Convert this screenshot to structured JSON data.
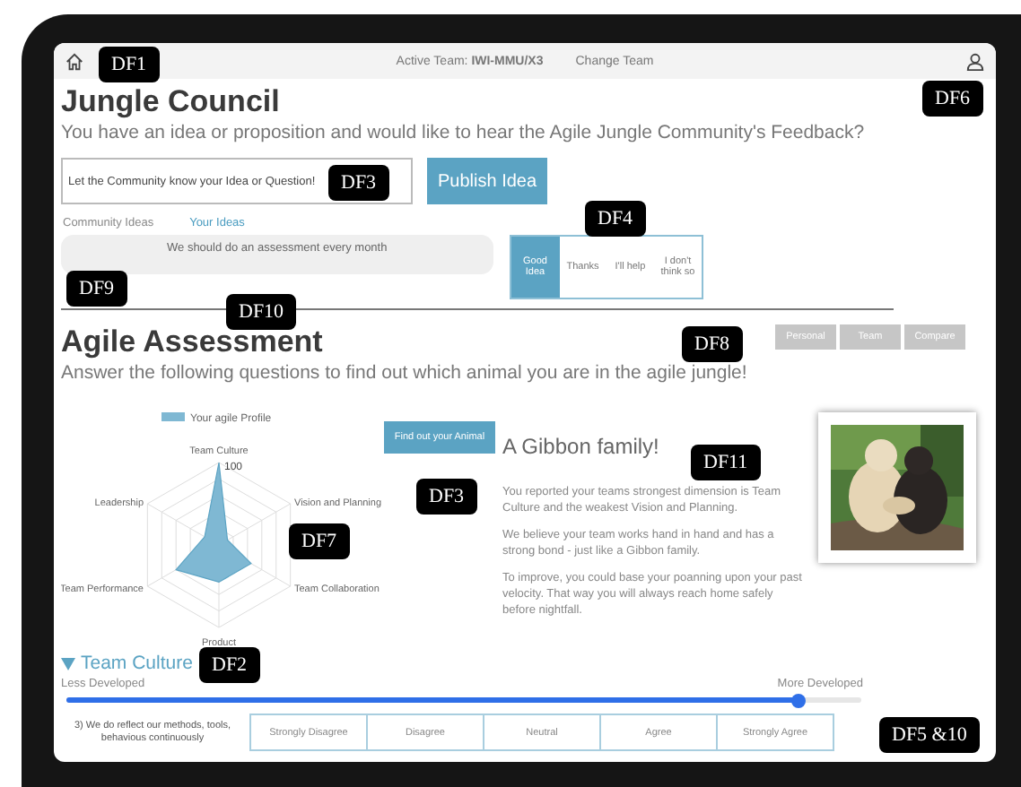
{
  "header": {
    "active_team": "Active Team: **IWI-MMU/X3**",
    "change_team": "Change Team"
  },
  "jungle_council": {
    "title": "Jungle Council",
    "subtitle": "You have an idea or proposition and would like to hear the Agile Jungle Community's Feedback?",
    "idea_input": {
      "placeholder": "Let the Community know your Idea or Question!"
    },
    "publish_button": "Publish Idea",
    "tabs": [
      {
        "label": "Community Ideas",
        "selected": false
      },
      {
        "label": "Your Ideas",
        "selected": true
      }
    ],
    "ideas": [
      {
        "text": "We should do an assessment every month"
      }
    ],
    "reactions": [
      {
        "label": "Good Idea",
        "selected": true
      },
      {
        "label": "Thanks",
        "selected": false
      },
      {
        "label": "I'll help",
        "selected": false
      },
      {
        "label": "I don't think so",
        "selected": false
      }
    ]
  },
  "agile_assessment": {
    "title": "Agile Assessment",
    "subtitle": "Answer the following questions to find out which animal you are in the agile jungle!",
    "view_buttons": [
      {
        "label": "Personal",
        "selected": false
      },
      {
        "label": "Team",
        "selected": false
      },
      {
        "label": "Compare",
        "selected": false
      }
    ],
    "radar": {
      "legend": "Your agile Profile",
      "tick": "100",
      "axes": [
        "Team Culture",
        "Leadership",
        "Vision and Planning",
        "Team Performance",
        "Team Collaboration",
        "Product"
      ]
    },
    "find_button": "Find out your Animal",
    "result": {
      "heading": "A Gibbon family!",
      "paragraphs": [
        "You reported your teams strongest dimension is Team Culture and the weakest Vision and Planning.",
        "We believe your team works hand in hand and has a strong bond - just like a Gibbon family.",
        "To improve, you could base your poanning upon your past velocity. That way you will always reach home safely before nightfall."
      ]
    }
  },
  "section": {
    "title": "Team Culture",
    "expanded": true,
    "low_label": "Less Developed",
    "high_label": "More Developed",
    "slider": {
      "level": 0.92
    }
  },
  "question": {
    "text": "3) We do reflect our methods, tools, behavious continuously",
    "options": [
      {
        "label": "Strongly Disagree",
        "selected": false
      },
      {
        "label": "Disagree",
        "selected": false
      },
      {
        "label": "Neutral",
        "selected": false
      },
      {
        "label": "Agree",
        "selected": false
      },
      {
        "label": "Strongly Agree",
        "selected": false
      }
    ]
  },
  "annotations": [
    {
      "label": "DF1"
    },
    {
      "label": "DF6"
    },
    {
      "label": "DF3"
    },
    {
      "label": "DF4"
    },
    {
      "label": "DF9"
    },
    {
      "label": "DF10"
    },
    {
      "label": "DF8"
    },
    {
      "label": "DF11"
    },
    {
      "label": "DF3"
    },
    {
      "label": "DF7"
    },
    {
      "label": "DF2"
    },
    {
      "label": "DF5 &10"
    }
  ]
}
